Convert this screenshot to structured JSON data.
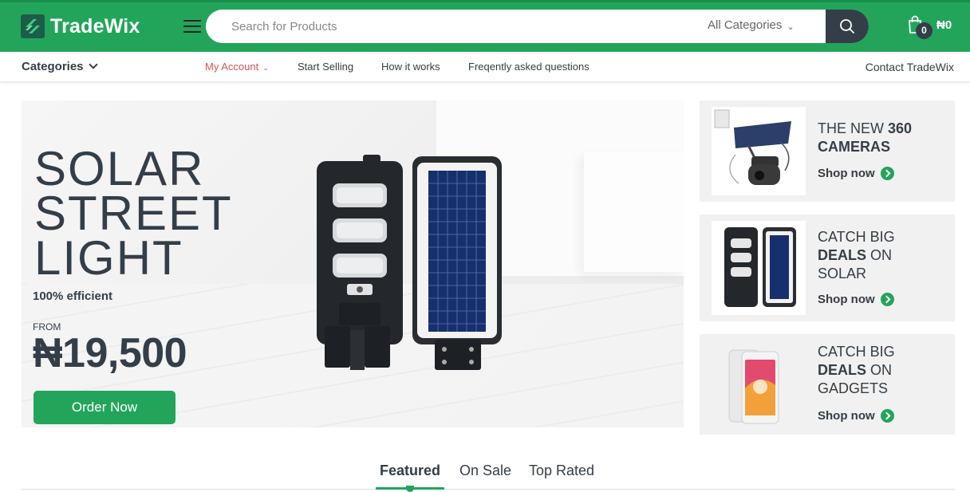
{
  "header": {
    "brand": "TradeWix",
    "search_placeholder": "Search for Products",
    "category_select": "All Categories",
    "cart_count": "0",
    "cart_total": "₦0"
  },
  "nav": {
    "categories": "Categories",
    "my_account": "My Account",
    "start_selling": "Start Selling",
    "how_it_works": "How it works",
    "faq": "Freqently asked questions",
    "contact": "Contact TradeWix"
  },
  "hero": {
    "title": "SOLAR\nSTREET\nLIGHT",
    "subtitle": "100% efficient",
    "from_label": "FROM",
    "price": "₦19,500",
    "cta": "Order Now"
  },
  "promos": [
    {
      "title_pre": "THE NEW ",
      "title_bold": "360",
      "title_line2_bold": "CAMERAS",
      "title_line2_rest": "",
      "title_line3": "",
      "shop": "Shop now"
    },
    {
      "title_pre": "CATCH BIG",
      "title_bold": "",
      "title_line2_bold": "DEALS",
      "title_line2_rest": " ON",
      "title_line3": "SOLAR",
      "shop": "Shop now"
    },
    {
      "title_pre": "CATCH BIG",
      "title_bold": "",
      "title_line2_bold": "DEALS",
      "title_line2_rest": " ON",
      "title_line3": "GADGETS",
      "shop": "Shop now"
    }
  ],
  "tabs": [
    "Featured",
    "On Sale",
    "Top Rated"
  ],
  "colors": {
    "brand_green": "#22a55a",
    "dark": "#333e48",
    "accent_red": "#d9534f"
  }
}
